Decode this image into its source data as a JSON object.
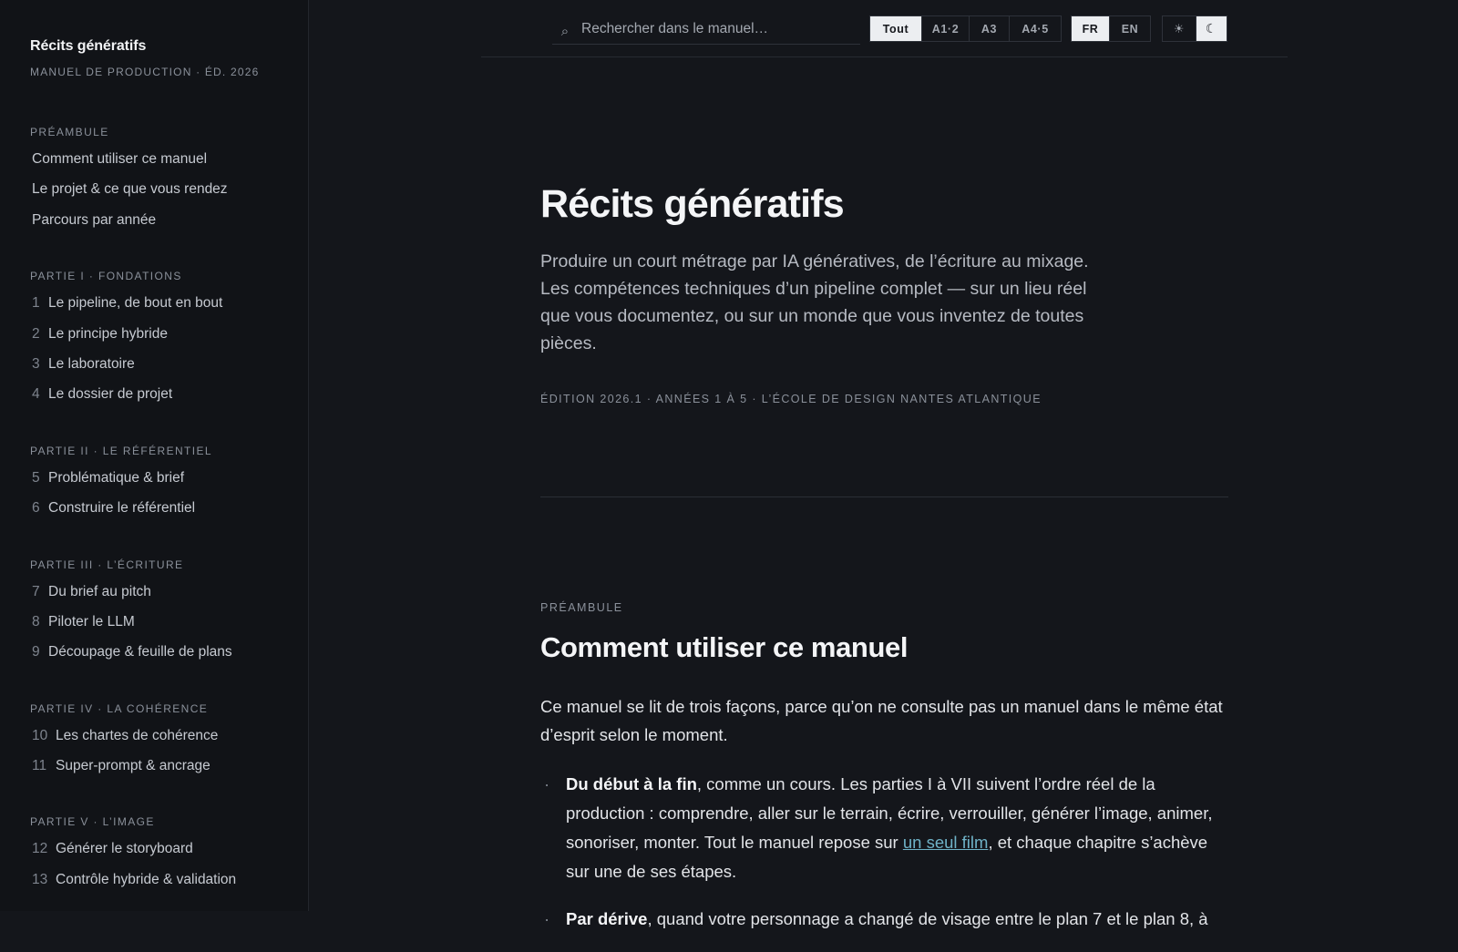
{
  "sidebar": {
    "title": "Récits génératifs",
    "subtitle": "MANUEL DE PRODUCTION · ÉD. 2026",
    "sections": [
      {
        "heading": "PRÉAMBULE",
        "items": [
          {
            "num": "",
            "label": "Comment utiliser ce manuel"
          },
          {
            "num": "",
            "label": "Le projet & ce que vous rendez"
          },
          {
            "num": "",
            "label": "Parcours par année"
          }
        ]
      },
      {
        "heading": "PARTIE I · FONDATIONS",
        "items": [
          {
            "num": "1",
            "label": "Le pipeline, de bout en bout"
          },
          {
            "num": "2",
            "label": "Le principe hybride"
          },
          {
            "num": "3",
            "label": "Le laboratoire"
          },
          {
            "num": "4",
            "label": "Le dossier de projet"
          }
        ]
      },
      {
        "heading": "PARTIE II · LE RÉFÉRENTIEL",
        "items": [
          {
            "num": "5",
            "label": "Problématique & brief"
          },
          {
            "num": "6",
            "label": "Construire le référentiel"
          }
        ]
      },
      {
        "heading": "PARTIE III · L’ÉCRITURE",
        "items": [
          {
            "num": "7",
            "label": "Du brief au pitch"
          },
          {
            "num": "8",
            "label": "Piloter le LLM"
          },
          {
            "num": "9",
            "label": "Découpage & feuille de plans"
          }
        ]
      },
      {
        "heading": "PARTIE IV · LA COHÉRENCE",
        "items": [
          {
            "num": "10",
            "label": "Les chartes de cohérence"
          },
          {
            "num": "11",
            "label": "Super-prompt & ancrage"
          }
        ]
      },
      {
        "heading": "PARTIE V · L’IMAGE",
        "items": [
          {
            "num": "12",
            "label": "Générer le storyboard"
          },
          {
            "num": "13",
            "label": "Contrôle hybride & validation"
          }
        ]
      }
    ]
  },
  "topbar": {
    "search_placeholder": "Rechercher dans le manuel…",
    "search_icon": "⌕",
    "level_options": [
      "Tout",
      "A1·2",
      "A3",
      "A4·5"
    ],
    "level_selected": "Tout",
    "lang_options": [
      "FR",
      "EN"
    ],
    "lang_selected": "FR",
    "theme_light_icon": "☀",
    "theme_dark_icon": "☾",
    "theme_selected": "dark"
  },
  "hero": {
    "title": "Récits génératifs",
    "lede": "Produire un court métrage par IA génératives, de l’écriture au mixage. Les compétences techniques d’un pipeline complet — sur un lieu réel que vous documentez, ou sur un monde que vous inventez de toutes pièces.",
    "edition": "ÉDITION 2026.1 · ANNÉES 1 À 5 · L’ÉCOLE DE DESIGN NANTES ATLANTIQUE"
  },
  "section": {
    "kicker": "PRÉAMBULE",
    "title": "Comment utiliser ce manuel",
    "intro": "Ce manuel se lit de trois façons, parce qu’on ne consulte pas un manuel dans le même état d’esprit selon le moment.",
    "list": [
      {
        "bold": "Du début à la fin",
        "text_before_link": ", comme un cours. Les parties I à VII suivent l’ordre réel de la production : comprendre, aller sur le terrain, écrire, verrouiller, générer l’image, animer, sonoriser, monter. Tout le manuel repose sur ",
        "link": "un seul film",
        "text_after_link": ", et chaque chapitre s’achève sur une de ses étapes."
      },
      {
        "bold": "Par dérive",
        "text_before_link": ", quand votre personnage a changé de visage entre le plan 7 et le plan 8, à",
        "link": "",
        "text_after_link": ""
      }
    ]
  },
  "colors": {
    "background": "#14161b",
    "sidebar": "#111317",
    "link": "#6fb2c7",
    "active_segment": "#eceef1"
  }
}
